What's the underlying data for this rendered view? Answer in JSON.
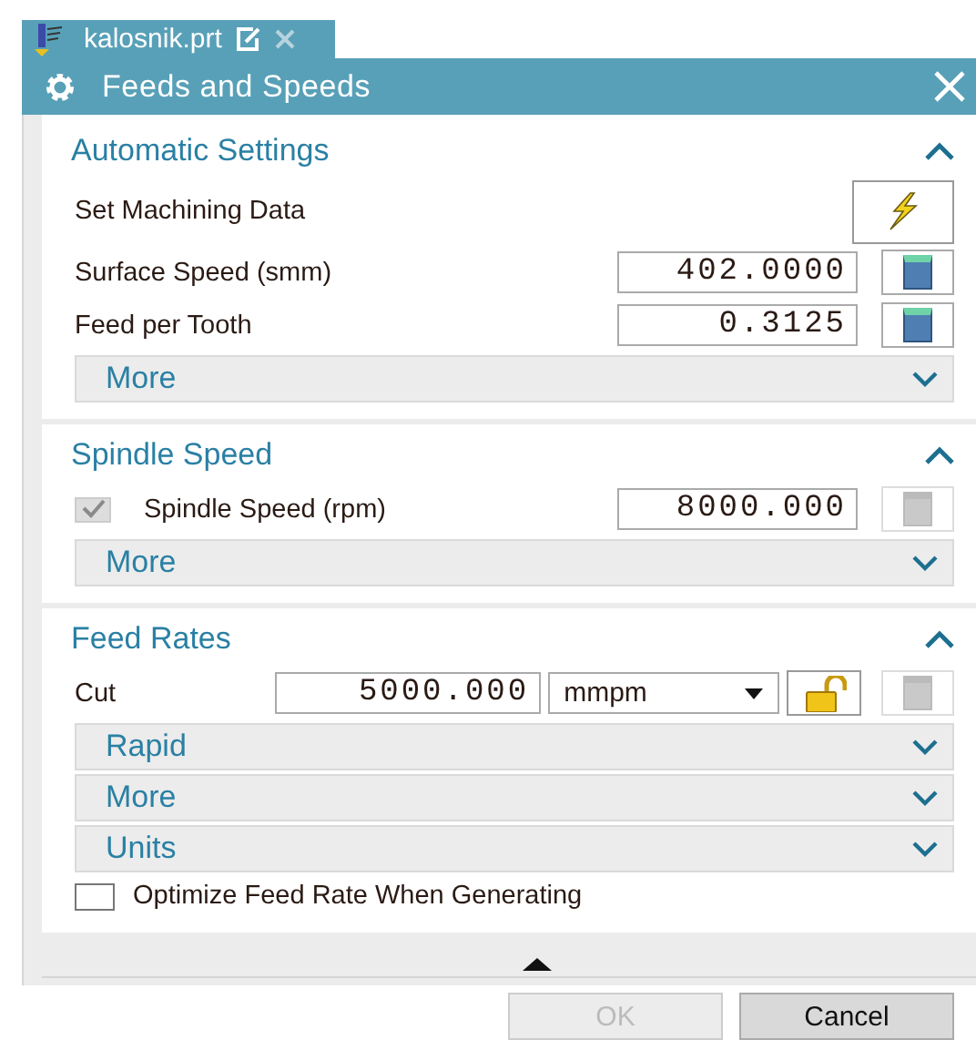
{
  "tab": {
    "title": "kalosnik.prt",
    "selected": true
  },
  "dialog": {
    "title": "Feeds and Speeds"
  },
  "sections": [
    {
      "title": "Automatic Settings",
      "expanded": true,
      "items": [
        {
          "kind": "action",
          "label": "Set Machining Data"
        },
        {
          "kind": "field",
          "label": "Surface Speed (smm)",
          "value": "402.0000",
          "calculator_disabled": false
        },
        {
          "kind": "field",
          "label": "Feed per Tooth",
          "value": "0.3125",
          "calculator_disabled": false
        },
        {
          "kind": "group",
          "label": "More",
          "expanded": false
        }
      ]
    },
    {
      "title": "Spindle Speed",
      "expanded": true,
      "items": [
        {
          "kind": "checkfield",
          "label": "Spindle Speed (rpm)",
          "value": "8000.000",
          "checked": true,
          "disabled": true,
          "calculator_disabled": true
        },
        {
          "kind": "group",
          "label": "More",
          "expanded": false
        }
      ]
    },
    {
      "title": "Feed Rates",
      "expanded": true,
      "items": [
        {
          "kind": "unitfield",
          "label": "Cut",
          "value": "5000.000",
          "unit": "mmpm",
          "locked": false,
          "calculator_disabled": true
        },
        {
          "kind": "group",
          "label": "Rapid",
          "expanded": false
        },
        {
          "kind": "group",
          "label": "More",
          "expanded": false
        },
        {
          "kind": "group",
          "label": "Units",
          "expanded": false
        },
        {
          "kind": "checkbox",
          "label": "Optimize Feed Rate When Generating",
          "checked": false
        }
      ]
    }
  ],
  "buttons": [
    {
      "label": "OK",
      "disabled": true
    },
    {
      "label": "Cancel",
      "disabled": false
    }
  ]
}
